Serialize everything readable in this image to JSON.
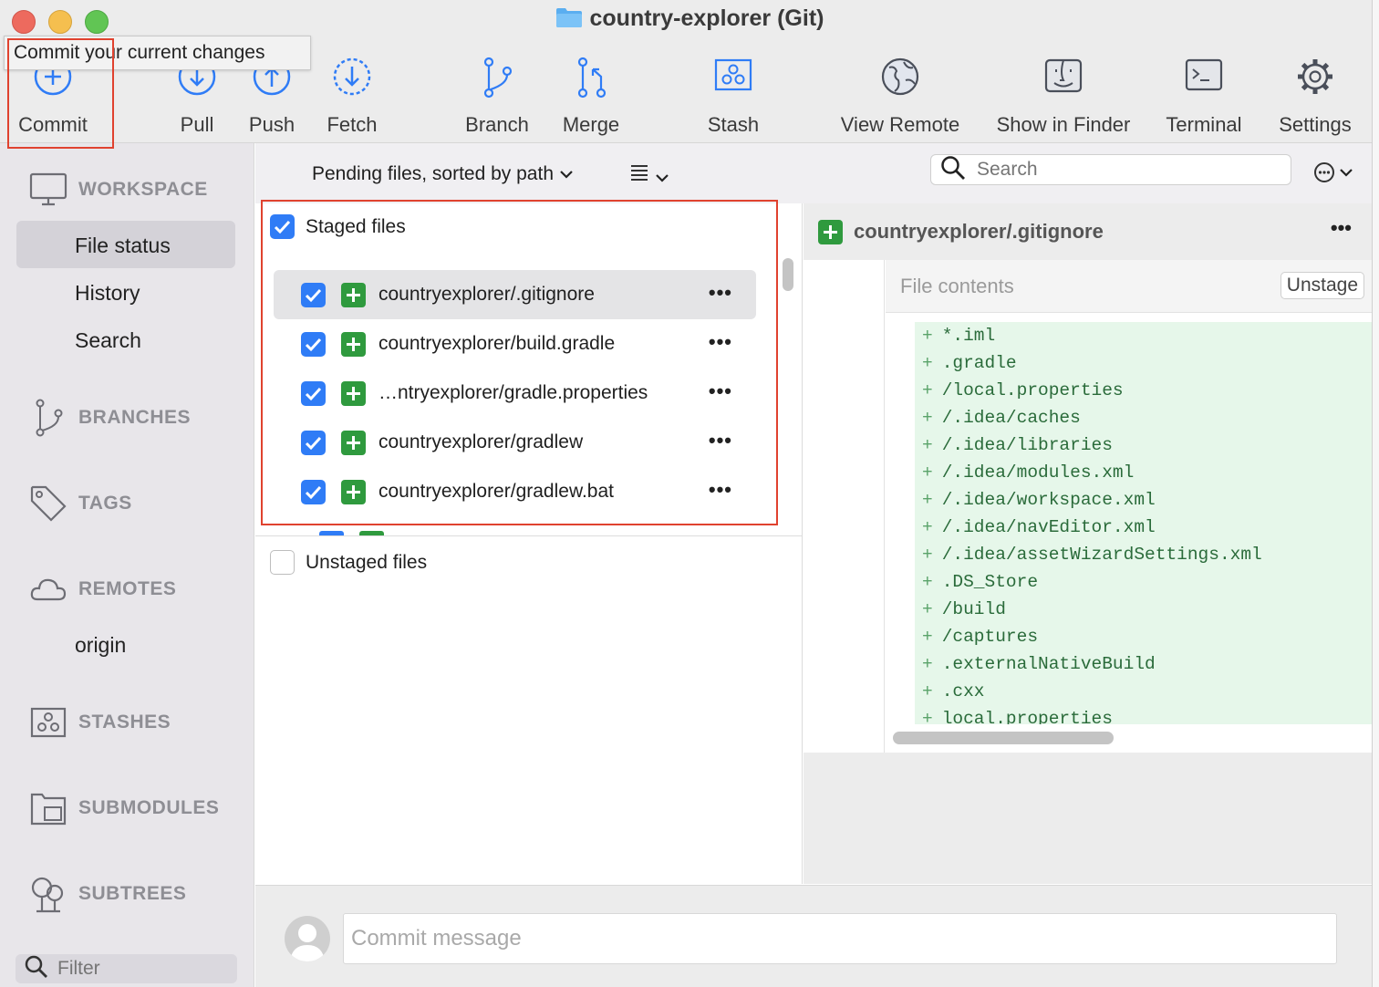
{
  "window": {
    "title": "country-explorer (Git)"
  },
  "toolbar": {
    "tooltip": "Commit your current changes",
    "buttons": [
      {
        "label": "Commit",
        "icon": "commit-plus-icon"
      },
      {
        "label": "Pull",
        "icon": "pull-arrow-down-icon"
      },
      {
        "label": "Push",
        "icon": "push-arrow-up-icon"
      },
      {
        "label": "Fetch",
        "icon": "fetch-dashed-arrow-icon"
      },
      {
        "label": "Branch",
        "icon": "branch-icon"
      },
      {
        "label": "Merge",
        "icon": "merge-icon"
      },
      {
        "label": "Stash",
        "icon": "stash-box-icon"
      },
      {
        "label": "View Remote",
        "icon": "globe-icon"
      },
      {
        "label": "Show in Finder",
        "icon": "finder-icon"
      },
      {
        "label": "Terminal",
        "icon": "terminal-icon"
      },
      {
        "label": "Settings",
        "icon": "gear-icon"
      }
    ]
  },
  "sidebar": {
    "workspace": {
      "title": "WORKSPACE",
      "items": [
        "File status",
        "History",
        "Search"
      ],
      "selected": "File status"
    },
    "branches": {
      "title": "BRANCHES"
    },
    "tags": {
      "title": "TAGS"
    },
    "remotes": {
      "title": "REMOTES",
      "items": [
        "origin"
      ]
    },
    "stashes": {
      "title": "STASHES"
    },
    "submodules": {
      "title": "SUBMODULES"
    },
    "subtrees": {
      "title": "SUBTREES"
    },
    "filter_placeholder": "Filter"
  },
  "listbar": {
    "sort_label": "Pending files, sorted by path",
    "search_placeholder": "Search"
  },
  "staged": {
    "header": "Staged files",
    "files": [
      {
        "name": "countryexplorer/.gitignore",
        "selected": true
      },
      {
        "name": "countryexplorer/build.gradle",
        "selected": false
      },
      {
        "name": "…ntryexplorer/gradle.properties",
        "selected": false
      },
      {
        "name": "countryexplorer/gradlew",
        "selected": false
      },
      {
        "name": "countryexplorer/gradlew.bat",
        "selected": false
      }
    ],
    "more": "•••"
  },
  "unstaged": {
    "header": "Unstaged files"
  },
  "diff": {
    "file": "countryexplorer/.gitignore",
    "more": "•••",
    "hunk_label": "File contents",
    "unstage_label": "Unstage",
    "lines": [
      "*.iml",
      ".gradle",
      "/local.properties",
      "/.idea/caches",
      "/.idea/libraries",
      "/.idea/modules.xml",
      "/.idea/workspace.xml",
      "/.idea/navEditor.xml",
      "/.idea/assetWizardSettings.xml",
      ".DS_Store",
      "/build",
      "/captures",
      ".externalNativeBuild",
      ".cxx",
      "local.properties"
    ],
    "add_prefix": "+"
  },
  "commit": {
    "placeholder": "Commit message"
  },
  "colors": {
    "accent": "#2f7cf6",
    "added": "#2f9a3e",
    "highlight": "#e0422f"
  }
}
